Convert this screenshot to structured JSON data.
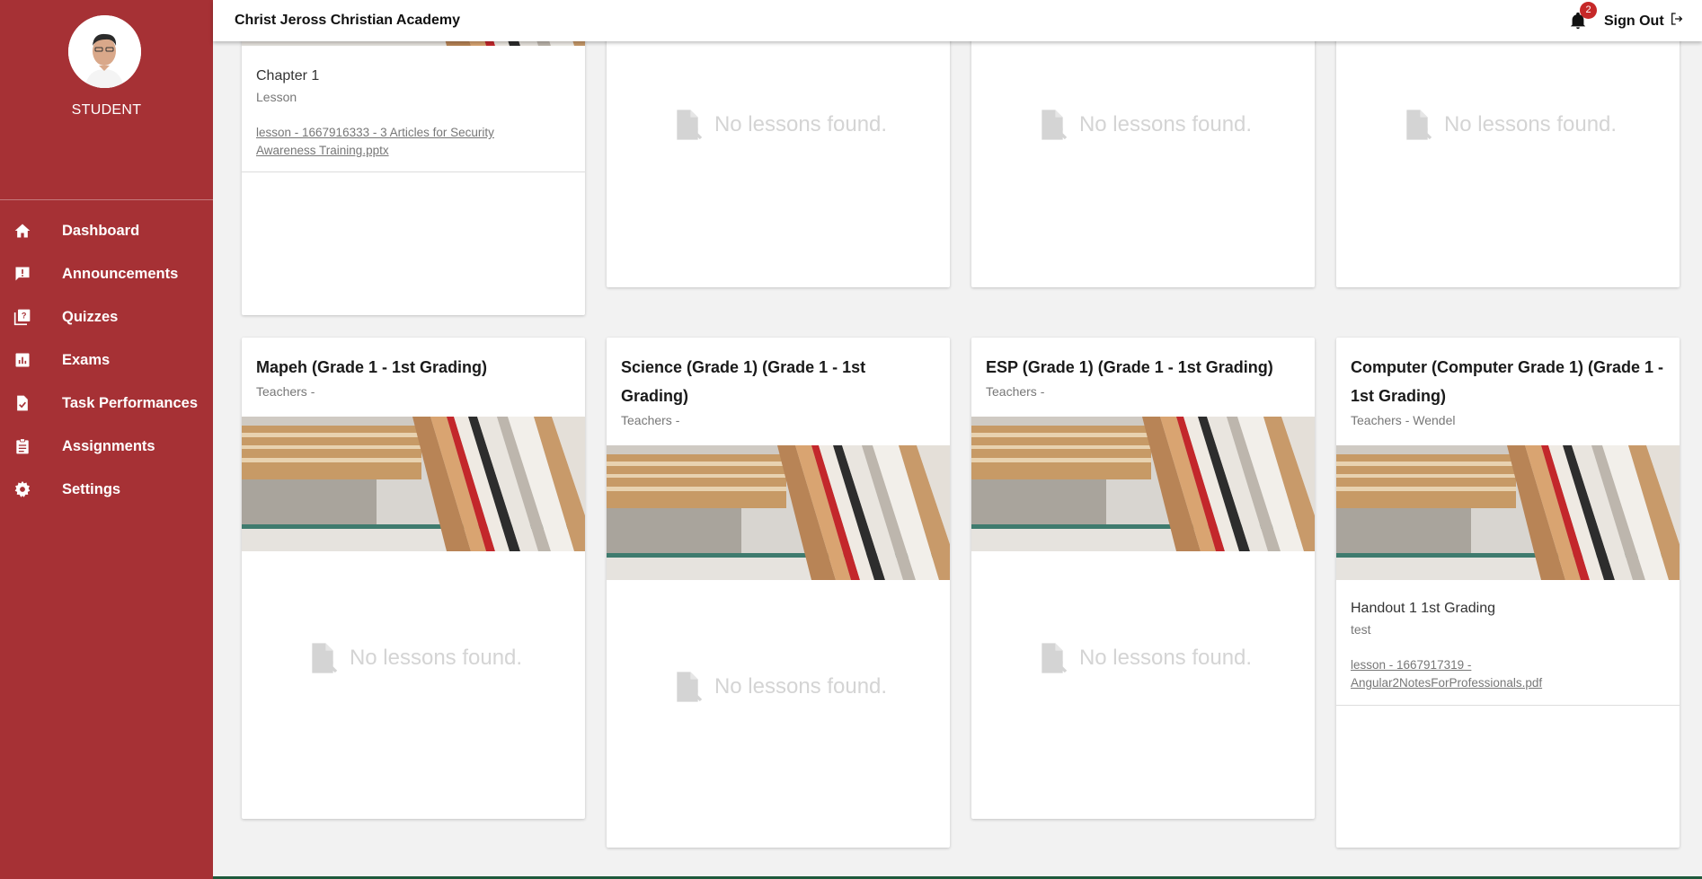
{
  "app": {
    "school_name": "Christ Jeross Christian Academy",
    "notification_count": "2",
    "sign_out_label": "Sign Out"
  },
  "sidebar": {
    "role": "STUDENT",
    "items": [
      {
        "label": "Dashboard",
        "icon": "home-icon"
      },
      {
        "label": "Announcements",
        "icon": "announcement-icon"
      },
      {
        "label": "Quizzes",
        "icon": "quiz-icon"
      },
      {
        "label": "Exams",
        "icon": "chart-icon"
      },
      {
        "label": "Task Performances",
        "icon": "task-icon"
      },
      {
        "label": "Assignments",
        "icon": "assignment-icon"
      },
      {
        "label": "Settings",
        "icon": "gear-icon"
      }
    ]
  },
  "top_cards": [
    {
      "lesson_title": "Chapter 1",
      "lesson_type": "Lesson",
      "lesson_link": "lesson - 1667916333 - 3 Articles for Security Awareness Training.pptx"
    },
    {
      "empty_text": "No lessons found."
    },
    {
      "empty_text": "No lessons found."
    },
    {
      "empty_text": "No lessons found."
    }
  ],
  "courses": [
    {
      "title": "Mapeh (Grade 1 - 1st Grading)",
      "teachers": "Teachers -",
      "empty_text": "No lessons found."
    },
    {
      "title": "Science (Grade 1) (Grade 1 - 1st Grading)",
      "teachers": "Teachers -",
      "empty_text": "No lessons found."
    },
    {
      "title": "ESP (Grade 1) (Grade 1 - 1st Grading)",
      "teachers": "Teachers -",
      "empty_text": "No lessons found."
    },
    {
      "title": "Computer (Computer Grade 1) (Grade 1 - 1st Grading)",
      "teachers": "Teachers - Wendel",
      "lesson_title": "Handout 1 1st Grading",
      "lesson_type": "test",
      "lesson_link": "lesson - 1667917319 - Angular2NotesForProfessionals.pdf"
    }
  ],
  "colors": {
    "sidebar": "#a63135",
    "background": "#f2f2f2",
    "badge": "#c62828"
  }
}
